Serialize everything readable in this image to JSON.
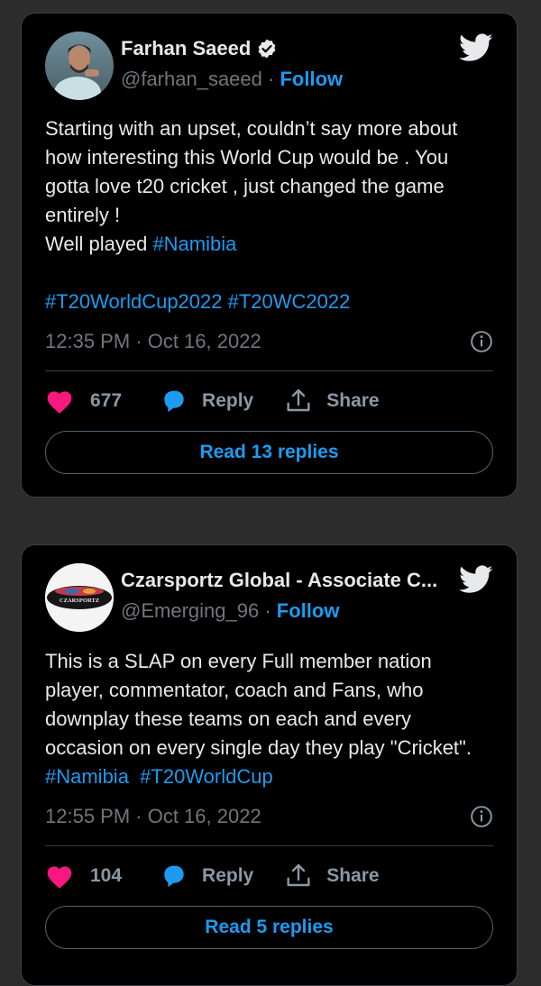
{
  "tweets": [
    {
      "author": {
        "display_name": "Farhan Saeed",
        "handle": "@farhan_saeed",
        "verified": true
      },
      "follow_label": "Follow",
      "separator": "·",
      "text_lines": [
        {
          "text": "Starting with an upset, couldn’t say more about how interesting this World Cup would be . You gotta love t20 cricket , just changed the game entirely !\nWell played "
        },
        {
          "tag": "#Namibia"
        },
        {
          "text": "\n\n"
        },
        {
          "tag": "#T20WorldCup2022"
        },
        {
          "text": " "
        },
        {
          "tag": "#T20WC2022"
        }
      ],
      "timestamp": "12:35 PM · Oct 16, 2022",
      "likes": "677",
      "reply_label": "Reply",
      "share_label": "Share",
      "read_replies_label": "Read 13 replies"
    },
    {
      "author": {
        "display_name": "Czarsportz Global - Associate C...",
        "handle": "@Emerging_96",
        "verified": false,
        "avatar_text": "CZARSPORTZ"
      },
      "follow_label": "Follow",
      "separator": "·",
      "text_lines": [
        {
          "text": "This is a SLAP on every Full member nation player, commentator, coach and Fans, who downplay these teams on each and every occasion on every single day they play \"Cricket\".\n"
        },
        {
          "tag": "#Namibia"
        },
        {
          "text": "  "
        },
        {
          "tag": "#T20WorldCup"
        }
      ],
      "timestamp": "12:55 PM · Oct 16, 2022",
      "likes": "104",
      "reply_label": "Reply",
      "share_label": "Share",
      "read_replies_label": "Read 5 replies"
    }
  ],
  "colors": {
    "background": "#2c2c2c",
    "card": "#000000",
    "link": "#1d9bf0",
    "heart": "#f91880",
    "muted": "#71767b"
  },
  "icons": [
    "twitter-bird-icon",
    "verified-badge-icon",
    "heart-icon",
    "reply-bubble-icon",
    "share-icon",
    "info-icon"
  ]
}
